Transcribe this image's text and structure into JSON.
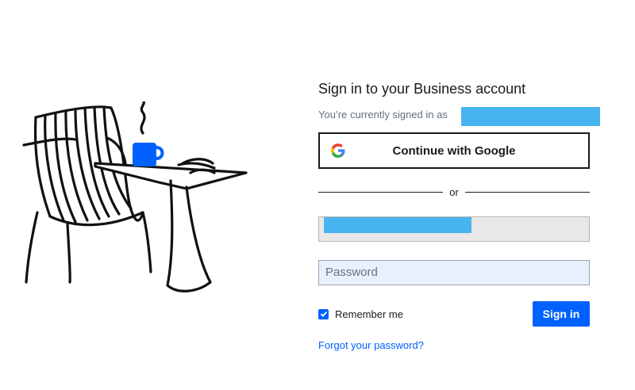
{
  "title": "Sign in to your Business account",
  "signed_in_text": "You’re currently signed in as",
  "google_button": "Continue with Google",
  "divider_text": "or",
  "email": {
    "value": ""
  },
  "password": {
    "placeholder": "Password"
  },
  "remember_label": "Remember me",
  "remember_checked": true,
  "signin_button": "Sign in",
  "forgot_link": "Forgot your password?",
  "colors": {
    "accent": "#0061fe",
    "redaction": "#47b4ef",
    "text": "#1e1919"
  },
  "icons": [
    "desk-chair-illustration",
    "google-g-icon",
    "checkbox-check-icon"
  ]
}
